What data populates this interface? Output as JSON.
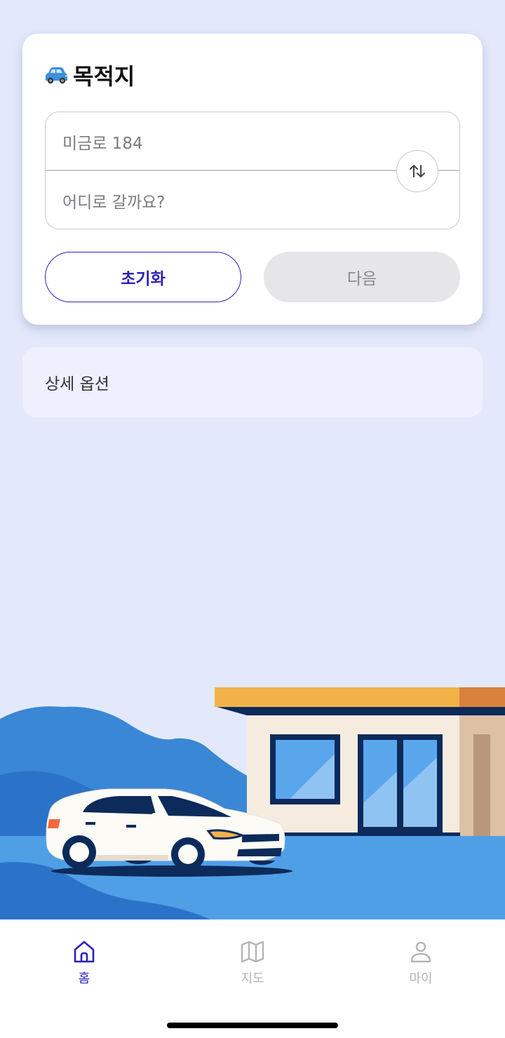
{
  "card": {
    "title": "목적지",
    "title_icon": "car-icon",
    "origin_value": "미금로 184",
    "destination_placeholder": "어디로 갈까요?",
    "swap_icon": "swap-arrows-icon",
    "reset_label": "초기화",
    "next_label": "다음"
  },
  "detail": {
    "label": "상세 옵션"
  },
  "nav": {
    "items": [
      {
        "label": "홈",
        "icon": "home-icon",
        "active": true
      },
      {
        "label": "지도",
        "icon": "map-icon",
        "active": false
      },
      {
        "label": "마이",
        "icon": "person-icon",
        "active": false
      }
    ]
  },
  "colors": {
    "background": "#e3e9fb",
    "accent": "#2a22b8",
    "card": "#ffffff",
    "detail_bg": "#eef1fd",
    "disabled_button": "#e6e6e8"
  }
}
